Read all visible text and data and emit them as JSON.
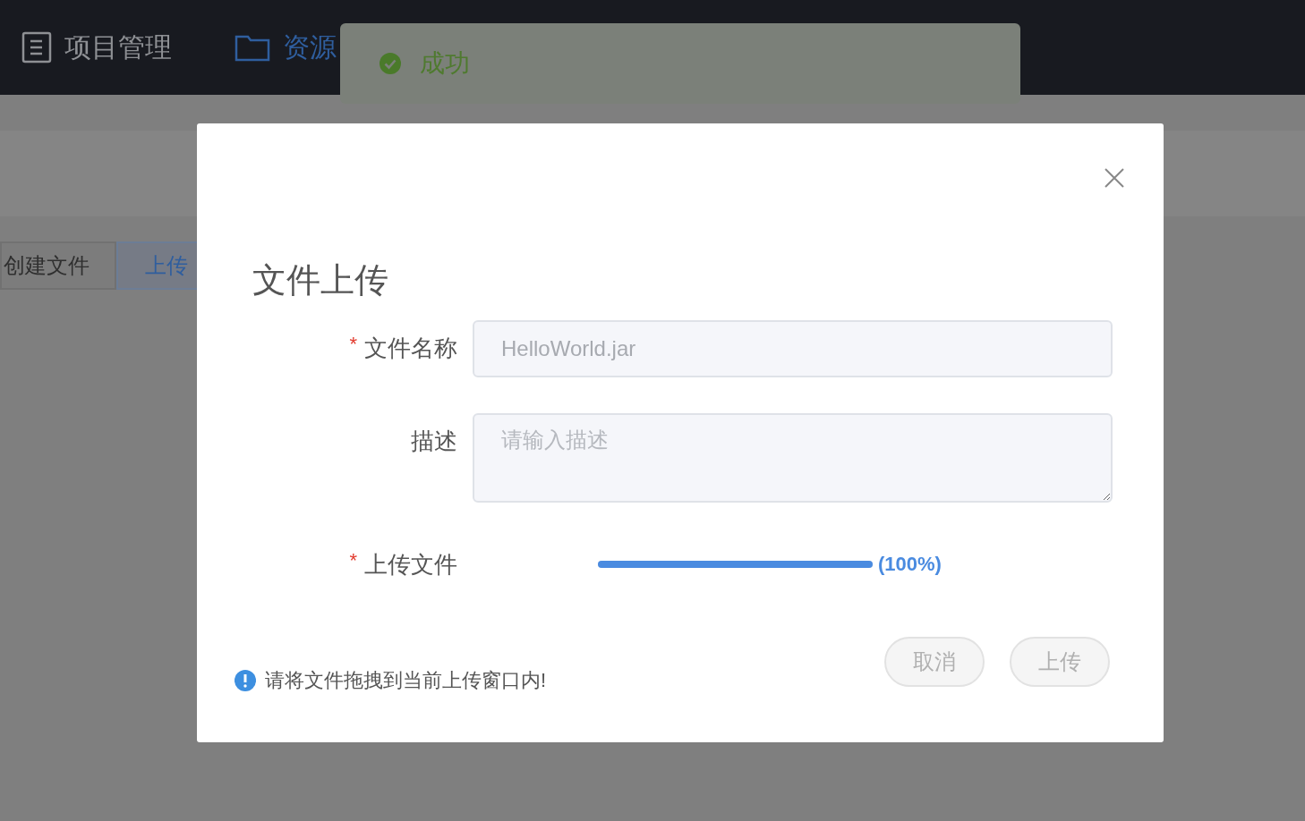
{
  "header": {
    "items": [
      {
        "kind": "doc",
        "label": "项目管理",
        "selected": false
      },
      {
        "kind": "folder",
        "label": "资源",
        "selected": true
      }
    ]
  },
  "toolbar": {
    "buttons": [
      {
        "label": "创建文件",
        "selected": false
      },
      {
        "label": "上传",
        "selected": true
      }
    ]
  },
  "toast": {
    "kind": "success",
    "message": "成功"
  },
  "dialog": {
    "title": "文件上传",
    "fields": [
      {
        "kind": "input",
        "label": "文件名称",
        "required_mark": "*",
        "value": "HelloWorld.jar"
      },
      {
        "kind": "textarea",
        "label": "描述",
        "placeholder": "请输入描述"
      },
      {
        "kind": "progress",
        "label": "上传文件",
        "required_mark": "*",
        "level": 1,
        "reading": "(100%)"
      }
    ],
    "note": "请将文件拖拽到当前上传窗口内!",
    "buttons": [
      {
        "label": "取消",
        "disabled": true
      },
      {
        "label": "上传",
        "disabled": true
      }
    ]
  }
}
